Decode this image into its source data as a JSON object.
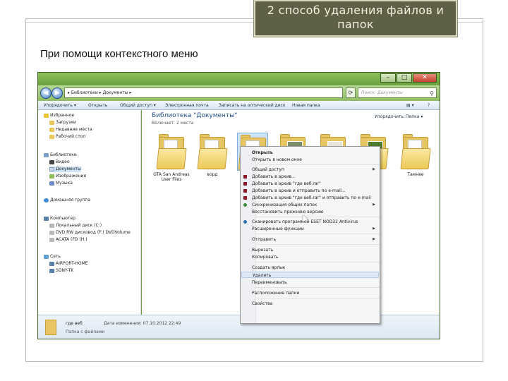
{
  "slide": {
    "title": "2 способ удаления файлов и папок",
    "subtitle": "При помощи контекстного меню"
  },
  "window": {
    "controls": {
      "minimize": "–",
      "maximize": "□",
      "close": "✕"
    },
    "address": "▸ Библиотеки ▸ Документы ▸",
    "address_refresh": "⟳",
    "search_placeholder": "Поиск: Документы",
    "toolbar": {
      "organize": "Упорядочить ▾",
      "open": "Открыть",
      "share": "Общий доступ ▾",
      "email": "Электронная почта",
      "burn": "Записать на оптический диск",
      "new_folder": "Новая папка",
      "views": "▤ ▾",
      "help": "?"
    }
  },
  "nav_pane": {
    "items": [
      {
        "label": "Избранное",
        "icon": "star-icon"
      },
      {
        "label": "Загрузки",
        "icon": "folder-icon"
      },
      {
        "label": "Недавние места",
        "icon": "folder-icon"
      },
      {
        "label": "Рабочий стол",
        "icon": "folder-icon"
      },
      {
        "label": "Библиотеки",
        "icon": "library-icon"
      },
      {
        "label": "Видео",
        "icon": "video-icon"
      },
      {
        "label": "Документы",
        "icon": "document-icon"
      },
      {
        "label": "Изображения",
        "icon": "picture-icon"
      },
      {
        "label": "Музыка",
        "icon": "music-icon"
      },
      {
        "label": "Домашняя группа",
        "icon": "homegroup-icon"
      },
      {
        "label": "Компьютер",
        "icon": "computer-icon"
      },
      {
        "label": "Локальный диск (C:)",
        "icon": "drive-icon"
      },
      {
        "label": "DVD RW дисковод (F:) DVDVolume",
        "icon": "drive-icon"
      },
      {
        "label": "ACATA (FD (H:)",
        "icon": "drive-icon"
      },
      {
        "label": "Сеть",
        "icon": "network-icon"
      },
      {
        "label": "AIRPORT-HOME",
        "icon": "computer-icon"
      },
      {
        "label": "SONY-TK",
        "icon": "computer-icon"
      }
    ]
  },
  "content": {
    "library_title": "Библиотека \"Документы\"",
    "library_sub": "Включает: 2 места",
    "arrange_label": "Упорядочить:",
    "arrange_value": "Папка ▾",
    "folders": [
      {
        "label": "GTA San Andreas User Files"
      },
      {
        "label": "ворд"
      },
      {
        "label": ""
      },
      {
        "label": ""
      },
      {
        "label": ""
      },
      {
        "label": ""
      },
      {
        "label": "Тамнее"
      }
    ]
  },
  "context_menu": {
    "items": [
      {
        "label": "Открыть",
        "bold": true
      },
      {
        "label": "Открыть в новом окне"
      },
      {
        "label": "Общий доступ",
        "submenu": true
      },
      {
        "label": "Добавить в архив..."
      },
      {
        "label": "Добавить в архив \"где веб.rar\""
      },
      {
        "label": "Добавить в архив и отправить по e-mail..."
      },
      {
        "label": "Добавить в архив \"где веб.rar\" и отправить по e-mail"
      },
      {
        "label": "Синхронизация общих папок",
        "submenu": true
      },
      {
        "label": "Восстановить прежнюю версию"
      },
      {
        "label": "Сканировать программой ESET NOD32 Antivirus"
      },
      {
        "label": "Расширенные функции",
        "submenu": true
      },
      {
        "label": "Отправить",
        "submenu": true
      },
      {
        "label": "Вырезать"
      },
      {
        "label": "Копировать"
      },
      {
        "label": "Создать ярлык"
      },
      {
        "label": "Удалить",
        "highlighted": true
      },
      {
        "label": "Переименовать"
      },
      {
        "label": "Расположение папки"
      },
      {
        "label": "Свойства"
      }
    ]
  },
  "details_pane": {
    "name": "где веб",
    "date": "Дата изменения: 07.10.2012 22:49",
    "type": "Папка с файлами"
  }
}
